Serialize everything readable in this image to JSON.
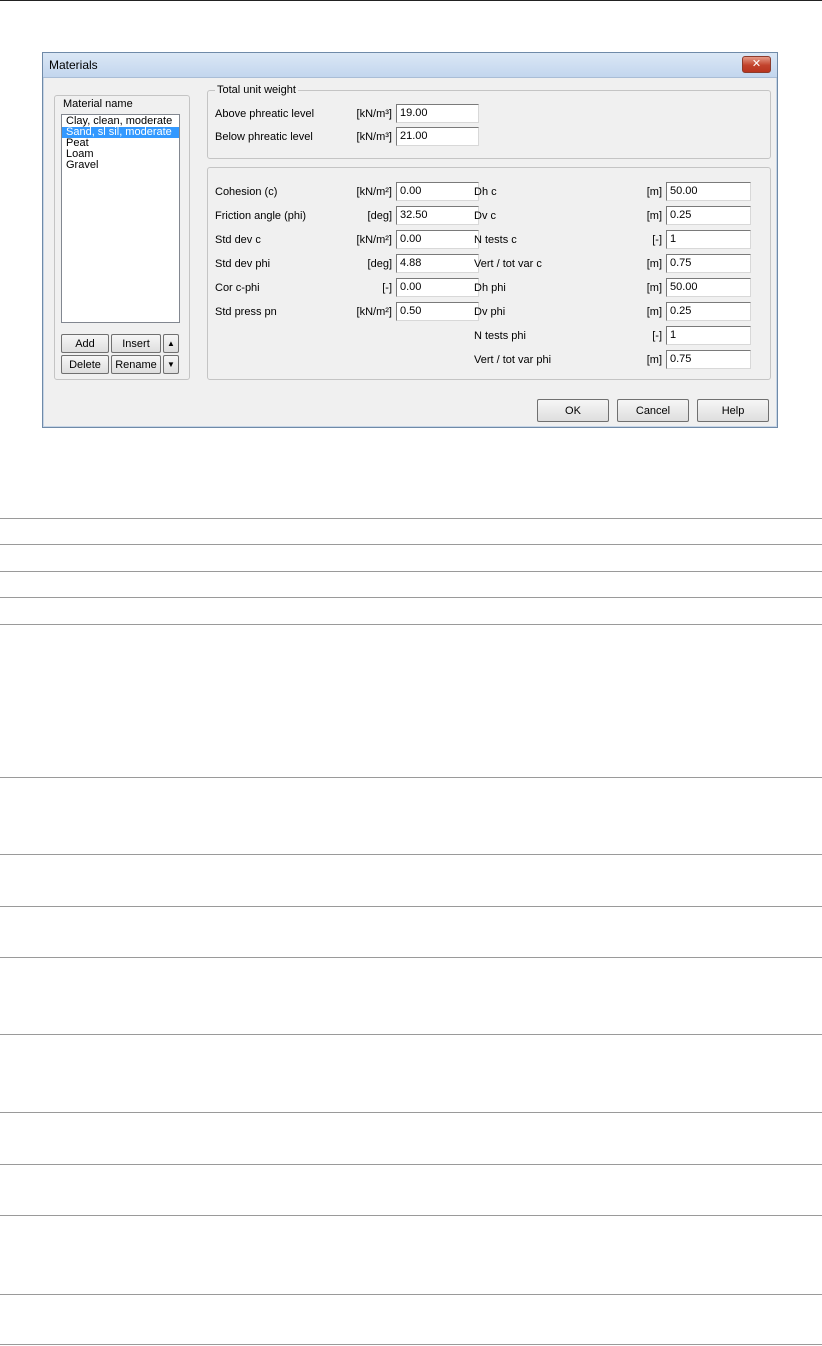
{
  "dialog": {
    "title": "Materials",
    "close_label": "✕"
  },
  "materials": {
    "label": "Material name",
    "items": [
      "Clay, clean, moderate",
      "Sand, sl sil, moderate",
      "Peat",
      "Loam",
      "Gravel"
    ],
    "selected_index": 1,
    "buttons": {
      "add": "Add",
      "insert": "Insert",
      "delete": "Delete",
      "rename": "Rename",
      "up": "▲",
      "down": "▼"
    }
  },
  "unit_weight": {
    "title": "Total unit weight",
    "above": {
      "label": "Above phreatic level",
      "unit": "[kN/m³]",
      "value": "19.00"
    },
    "below": {
      "label": "Below phreatic level",
      "unit": "[kN/m³]",
      "value": "21.00"
    }
  },
  "params_left": [
    {
      "label": "Cohesion (c)",
      "unit": "[kN/m²]",
      "value": "0.00"
    },
    {
      "label": "Friction angle (phi)",
      "unit": "[deg]",
      "value": "32.50"
    },
    {
      "label": "Std dev c",
      "unit": "[kN/m²]",
      "value": "0.00"
    },
    {
      "label": "Std dev phi",
      "unit": "[deg]",
      "value": "4.88"
    },
    {
      "label": "Cor c-phi",
      "unit": "[-]",
      "value": "0.00"
    },
    {
      "label": "Std press pn",
      "unit": "[kN/m²]",
      "value": "0.50"
    }
  ],
  "params_right": [
    {
      "label": "Dh c",
      "unit": "[m]",
      "value": "50.00"
    },
    {
      "label": "Dv c",
      "unit": "[m]",
      "value": "0.25"
    },
    {
      "label": "N tests c",
      "unit": "[-]",
      "value": "1"
    },
    {
      "label": "Vert / tot var c",
      "unit": "[m]",
      "value": "0.75"
    },
    {
      "label": "Dh phi",
      "unit": "[m]",
      "value": "50.00"
    },
    {
      "label": "Dv phi",
      "unit": "[m]",
      "value": "0.25"
    },
    {
      "label": "N tests phi",
      "unit": "[-]",
      "value": "1"
    },
    {
      "label": "Vert / tot var phi",
      "unit": "[m]",
      "value": "0.75"
    }
  ],
  "footer": {
    "ok": "OK",
    "cancel": "Cancel",
    "help": "Help"
  }
}
